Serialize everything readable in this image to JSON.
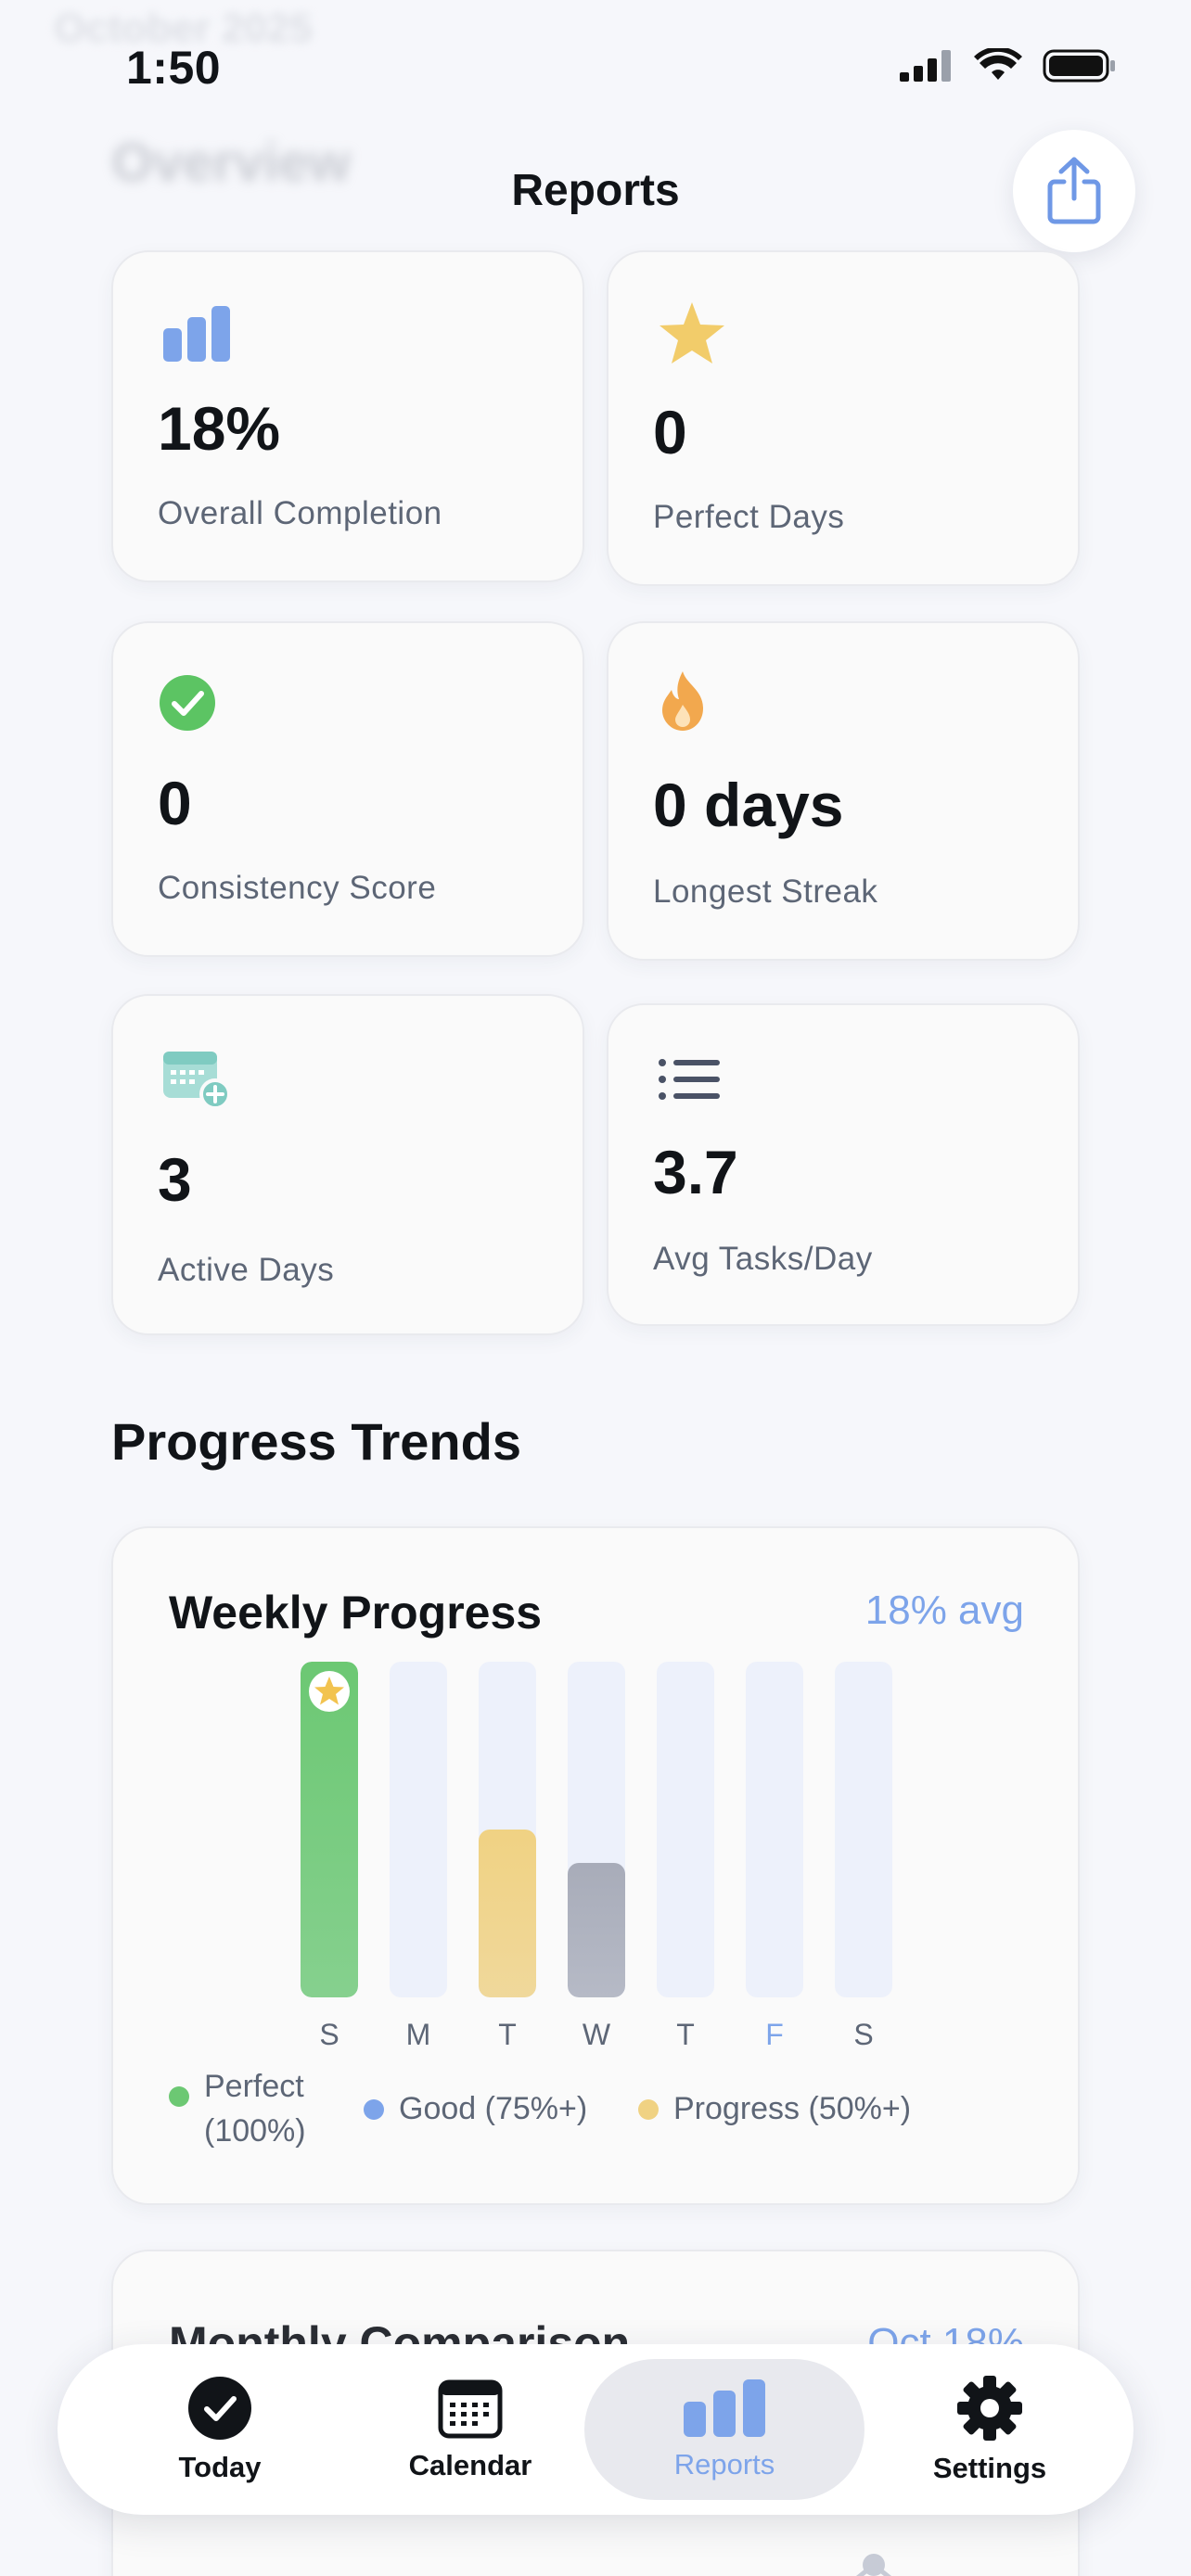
{
  "status": {
    "time": "1:50"
  },
  "ghost": {
    "month": "October 2025",
    "overview": "Overview"
  },
  "nav": {
    "title": "Reports"
  },
  "stats": [
    {
      "value": "18%",
      "label": "Overall Completion",
      "icon": "bar-chart-icon"
    },
    {
      "value": "0",
      "label": "Perfect Days",
      "icon": "star-icon"
    },
    {
      "value": "0",
      "label": "Consistency Score",
      "icon": "check-circle-icon"
    },
    {
      "value": "0 days",
      "label": "Longest Streak",
      "icon": "flame-icon"
    },
    {
      "value": "3",
      "label": "Active Days",
      "icon": "calendar-plus-icon"
    },
    {
      "value": "3.7",
      "label": "Avg Tasks/Day",
      "icon": "list-icon"
    }
  ],
  "section": {
    "title": "Progress Trends"
  },
  "weekly": {
    "title": "Weekly Progress",
    "avg": "18% avg",
    "days": [
      {
        "label": "S",
        "fill": 1.0,
        "color": "#6cc873",
        "star": true
      },
      {
        "label": "M",
        "fill": 0,
        "color": "#edf1fb"
      },
      {
        "label": "T",
        "fill": 0.5,
        "color": "#f0d283"
      },
      {
        "label": "W",
        "fill": 0.4,
        "color": "#a8acb9"
      },
      {
        "label": "T",
        "fill": 0,
        "color": "#edf1fb"
      },
      {
        "label": "F",
        "fill": 0,
        "color": "#edf1fb",
        "highlight": true
      },
      {
        "label": "S",
        "fill": 0,
        "color": "#edf1fb"
      }
    ],
    "legend": [
      {
        "label": "Perfect (100%)",
        "line1": "Perfect",
        "line2": "(100%)",
        "color": "#6cc873"
      },
      {
        "label": "Good (75%+)",
        "color": "#7da4ea"
      },
      {
        "label": "Progress (50%+)",
        "color": "#f0d283"
      }
    ]
  },
  "monthly": {
    "title": "Monthly Comparison",
    "value": "Oct 18%"
  },
  "tabs": [
    {
      "label": "Today",
      "icon": "check-circle-icon",
      "active": false
    },
    {
      "label": "Calendar",
      "icon": "calendar-icon",
      "active": false
    },
    {
      "label": "Reports",
      "icon": "bar-chart-icon",
      "active": true
    },
    {
      "label": "Settings",
      "icon": "gear-icon",
      "active": false
    }
  ],
  "colors": {
    "accent": "#7da4ea",
    "perfect": "#6cc873",
    "progress": "#f0d283"
  }
}
